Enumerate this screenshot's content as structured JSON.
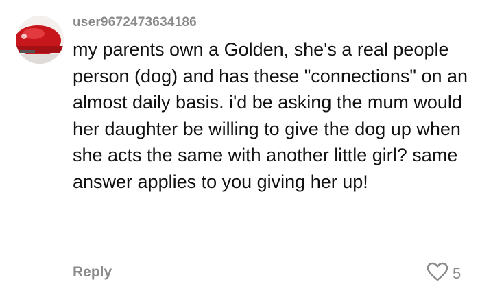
{
  "comment": {
    "username": "user9672473634186",
    "text": "my parents own a Golden, she's a real people person (dog) and has these \"connections\" on an almost daily basis. i'd be asking the mum would her daughter be willing to give the dog up when she acts the same with another little girl? same answer applies to you giving her up!",
    "reply_label": "Reply",
    "like_count": "5"
  },
  "colors": {
    "meta_text": "#8a8a8a",
    "body_text": "#111111",
    "avatar_primary": "#c8161d"
  },
  "icons": {
    "like": "heart-outline-icon"
  }
}
